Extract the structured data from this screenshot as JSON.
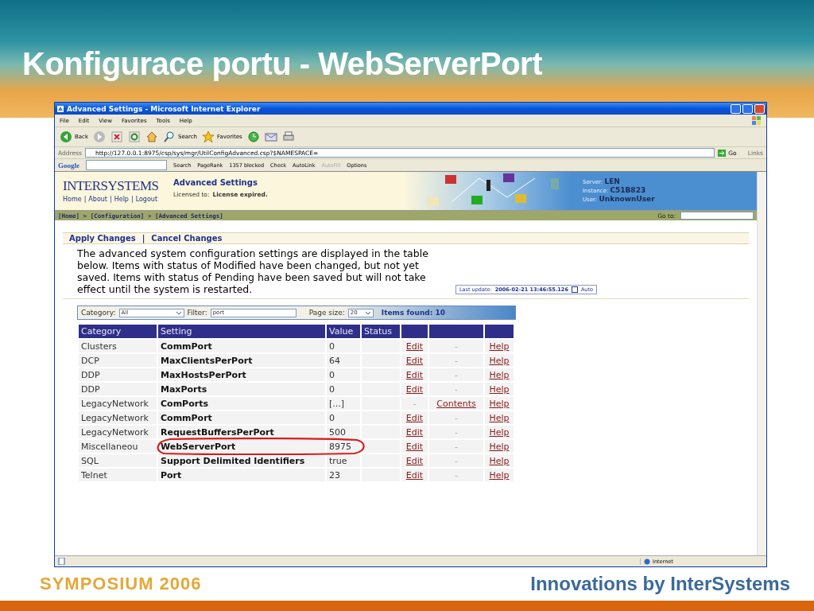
{
  "slide": {
    "title": "Konfigurace portu - WebServerPort",
    "footer_left": "SYMPOSIUM 2006",
    "footer_right": "Innovations by InterSystems"
  },
  "window": {
    "title": "Advanced Settings - Microsoft Internet Explorer"
  },
  "menu": [
    "File",
    "Edit",
    "View",
    "Favorites",
    "Tools",
    "Help"
  ],
  "toolbar": [
    {
      "kind": "back",
      "label": "Back"
    },
    {
      "kind": "forward"
    },
    {
      "kind": "stop"
    },
    {
      "kind": "refresh"
    },
    {
      "kind": "home"
    },
    {
      "kind": "search",
      "label": "Search"
    },
    {
      "kind": "favorites",
      "label": "Favorites"
    },
    {
      "kind": "history"
    },
    {
      "kind": "mail"
    },
    {
      "kind": "print"
    }
  ],
  "address_bar": {
    "label": "Address",
    "url": "http://127.0.0.1:8975/csp/sys/mgr/UtilConfigAdvanced.csp?$NAMESPACE=",
    "go": "Go",
    "links": "Links"
  },
  "google_bar": {
    "logo": "Google",
    "items": [
      {
        "text": "Search",
        "disabled": false
      },
      {
        "text": "PageRank",
        "disabled": false
      },
      {
        "text": "1357 blocked",
        "disabled": false
      },
      {
        "text": "Check",
        "disabled": false
      },
      {
        "text": "AutoLink",
        "disabled": false
      },
      {
        "text": "AutoFill",
        "disabled": true
      },
      {
        "text": "Options",
        "disabled": false
      }
    ]
  },
  "page_header": {
    "logo": "INTERSYSTEMS",
    "nav": [
      "Home",
      "About",
      "Help",
      "Logout"
    ],
    "nav_separator": "|",
    "heading": "Advanced Settings",
    "license_label": "Licensed to:",
    "license": "License expired.",
    "info": [
      {
        "label": "Server:",
        "value": "LEN"
      },
      {
        "label": "Instance:",
        "value": "C51B823"
      },
      {
        "label": "User:",
        "value": "UnknownUser"
      }
    ]
  },
  "breadcrumb": "[Home] > [Configuration] > [Advanced Settings]",
  "goto_label": "Go to:",
  "actions": [
    "Apply Changes",
    "Cancel Changes"
  ],
  "actions_separator": "|",
  "description": "The advanced system configuration settings are displayed in the table below. Items with status of Modified have been changed, but not yet saved. Items with status of Pending have been saved but will not take effect until the system is restarted.",
  "last_update": {
    "label": "Last update:",
    "value": "2006-02-21 13:46:55.126",
    "auto_label": "Auto",
    "auto_checked": false
  },
  "filter": {
    "category_label": "Category:",
    "category": "All",
    "filter_label": "Filter:",
    "filter": "port",
    "page_size_label": "Page size:",
    "page_size": "20",
    "items_found": "Items found: 10"
  },
  "table": {
    "columns": [
      "Category",
      "Setting",
      "Value",
      "Status"
    ],
    "rows": [
      {
        "category": "Clusters",
        "setting": "CommPort",
        "value": "0",
        "circled": false,
        "links": [
          {
            "text": "Edit",
            "kind": "link"
          },
          {
            "text": "-",
            "kind": "dash"
          },
          {
            "text": "Help",
            "kind": "link"
          }
        ]
      },
      {
        "category": "DCP",
        "setting": "MaxClientsPerPort",
        "value": "64",
        "circled": false,
        "links": [
          {
            "text": "Edit",
            "kind": "link"
          },
          {
            "text": "-",
            "kind": "dash"
          },
          {
            "text": "Help",
            "kind": "link"
          }
        ]
      },
      {
        "category": "DDP",
        "setting": "MaxHostsPerPort",
        "value": "0",
        "circled": false,
        "links": [
          {
            "text": "Edit",
            "kind": "link"
          },
          {
            "text": "-",
            "kind": "dash"
          },
          {
            "text": "Help",
            "kind": "link"
          }
        ]
      },
      {
        "category": "DDP",
        "setting": "MaxPorts",
        "value": "0",
        "circled": false,
        "links": [
          {
            "text": "Edit",
            "kind": "link"
          },
          {
            "text": "-",
            "kind": "dash"
          },
          {
            "text": "Help",
            "kind": "link"
          }
        ]
      },
      {
        "category": "LegacyNetwork",
        "setting": "ComPorts",
        "value": "[...]",
        "circled": false,
        "links": [
          {
            "text": "-",
            "kind": "dash"
          },
          {
            "text": "Contents",
            "kind": "link"
          },
          {
            "text": "Help",
            "kind": "link"
          }
        ]
      },
      {
        "category": "LegacyNetwork",
        "setting": "CommPort",
        "value": "0",
        "circled": false,
        "links": [
          {
            "text": "Edit",
            "kind": "link"
          },
          {
            "text": "-",
            "kind": "dash"
          },
          {
            "text": "Help",
            "kind": "link"
          }
        ]
      },
      {
        "category": "LegacyNetwork",
        "setting": "RequestBuffersPerPort",
        "value": "500",
        "circled": false,
        "links": [
          {
            "text": "Edit",
            "kind": "link"
          },
          {
            "text": "-",
            "kind": "dash"
          },
          {
            "text": "Help",
            "kind": "link"
          }
        ]
      },
      {
        "category": "Miscellaneou",
        "setting": "WebServerPort",
        "value": "8975",
        "circled": true,
        "links": [
          {
            "text": "Edit",
            "kind": "link"
          },
          {
            "text": "-",
            "kind": "dash"
          },
          {
            "text": "Help",
            "kind": "link"
          }
        ]
      },
      {
        "category": "SQL",
        "setting": "Support Delimited Identifiers",
        "value": "true",
        "circled": false,
        "links": [
          {
            "text": "Edit",
            "kind": "link"
          },
          {
            "text": "-",
            "kind": "dash"
          },
          {
            "text": "Help",
            "kind": "link"
          }
        ]
      },
      {
        "category": "Telnet",
        "setting": "Port",
        "value": "23",
        "circled": false,
        "links": [
          {
            "text": "Edit",
            "kind": "link"
          },
          {
            "text": "-",
            "kind": "dash"
          },
          {
            "text": "Help",
            "kind": "link"
          }
        ]
      }
    ]
  },
  "status_bar": {
    "zone": "Internet"
  }
}
